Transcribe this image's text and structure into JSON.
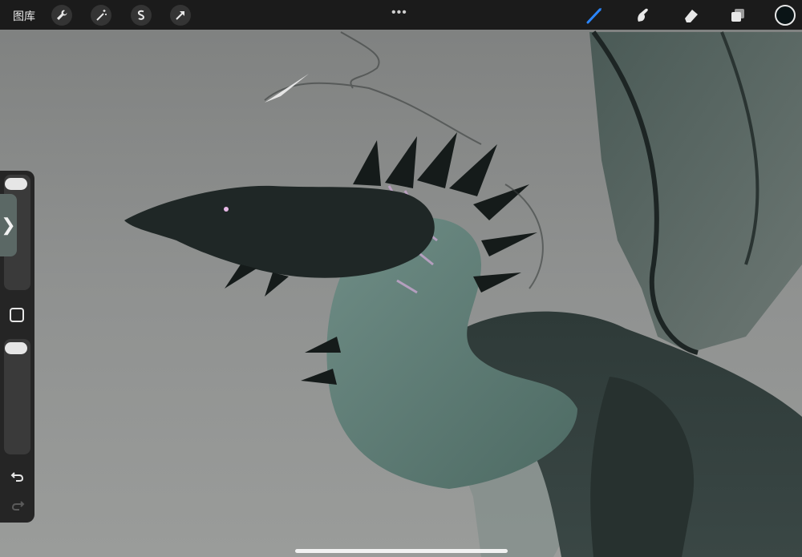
{
  "app": {
    "gallery_label": "图库",
    "more_icon": "ellipsis-icon"
  },
  "top_tools_left": [
    {
      "name": "actions",
      "icon": "wrench-icon"
    },
    {
      "name": "adjustments",
      "icon": "magic-wand-icon"
    },
    {
      "name": "selection",
      "icon": "selection-s-icon"
    },
    {
      "name": "transform",
      "icon": "arrow-cursor-icon"
    }
  ],
  "top_tools_right": [
    {
      "name": "brush",
      "icon": "brush-icon",
      "active": true
    },
    {
      "name": "smudge",
      "icon": "smudge-finger-icon",
      "active": false
    },
    {
      "name": "eraser",
      "icon": "eraser-icon",
      "active": false
    },
    {
      "name": "layers",
      "icon": "layers-icon",
      "active": false
    }
  ],
  "current_color": "#0a1416",
  "accent_color": "#2b86ff",
  "sidebar": {
    "expand_glyph": "❯",
    "undo_icon": "undo-icon",
    "redo_icon": "redo-icon"
  },
  "artwork": {
    "subject": "dragon-illustration"
  }
}
